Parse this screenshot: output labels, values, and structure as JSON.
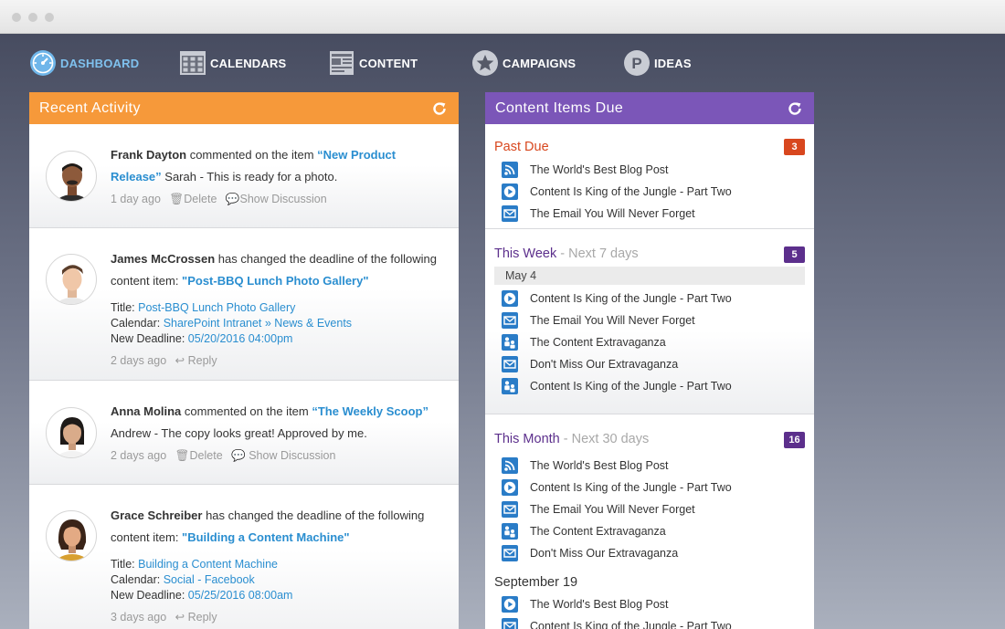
{
  "colors": {
    "accent_blue": "#2a8ed0",
    "orange": "#f6993a",
    "purple": "#7b56b8",
    "red": "#d8471e",
    "dark_purple": "#5c2f8c"
  },
  "nav": [
    {
      "label": "DASHBOARD",
      "icon": "dashboard-icon",
      "active": true
    },
    {
      "label": "CALENDARS",
      "icon": "calendar-icon"
    },
    {
      "label": "CONTENT",
      "icon": "content-icon"
    },
    {
      "label": "CAMPAIGNS",
      "icon": "star-icon"
    },
    {
      "label": "IDEAS",
      "icon": "ideas-icon"
    }
  ],
  "recent": {
    "title": "Recent Activity",
    "items": [
      {
        "name": "Frank Dayton",
        "action": " commented on the item ",
        "link": "“New Product Release”",
        "comment": " Sarah - This is ready for a photo.",
        "time": "1 day ago",
        "a1": "Delete",
        "a2": "Show Discussion"
      },
      {
        "name": "James McCrossen",
        "action": " has changed the deadline of the following content item: ",
        "link": "\"Post-BBQ Lunch Photo Gallery\"",
        "t_label": "Title: ",
        "t_val": "Post-BBQ Lunch Photo Gallery",
        "c_label": "Calendar: ",
        "c_val": "SharePoint Intranet » News & Events",
        "d_label": "New Deadline: ",
        "d_val": "05/20/2016 04:00pm",
        "time": "2 days ago",
        "a1": "Reply"
      },
      {
        "name": "Anna Molina",
        "action": " commented on the item ",
        "link": "“The Weekly Scoop”",
        "comment": "Andrew - The copy looks great! Approved by me.",
        "time": "2 days ago",
        "a1": "Delete",
        "a2": "Show Discussion"
      },
      {
        "name": "Grace Schreiber",
        "action": " has changed the deadline of the following content item: ",
        "link": "\"Building a Content Machine\"",
        "t_label": "Title: ",
        "t_val": "Building a Content Machine",
        "c_label": "Calendar: ",
        "c_val": "Social - Facebook",
        "d_label": "New Deadline: ",
        "d_val": "05/25/2016 08:00am",
        "time": "3 days ago",
        "a1": "Reply"
      }
    ]
  },
  "due": {
    "title": "Content Items Due",
    "past": {
      "title": "Past Due",
      "count": "3",
      "items": [
        {
          "icon": "rss-icon",
          "label": "The World's Best Blog Post"
        },
        {
          "icon": "video-icon",
          "label": "Content Is King of the Jungle - Part Two"
        },
        {
          "icon": "email-icon",
          "label": "The Email You Will Never Forget"
        }
      ]
    },
    "week": {
      "title": "This Week",
      "sub": " - Next 7 days",
      "count": "5",
      "day": "May 4",
      "items": [
        {
          "icon": "video-icon",
          "label": "Content Is King of the Jungle - Part Two"
        },
        {
          "icon": "email-icon",
          "label": "The Email You Will Never Forget"
        },
        {
          "icon": "people-icon",
          "label": "The Content Extravaganza"
        },
        {
          "icon": "email-icon",
          "label": "Don't Miss Our Extravaganza"
        },
        {
          "icon": "people-icon",
          "label": "Content Is King of the Jungle - Part Two"
        }
      ]
    },
    "month": {
      "title": "This Month",
      "sub": " - Next 30 days",
      "count": "16",
      "items": [
        {
          "icon": "rss-icon",
          "label": "The World's Best Blog Post"
        },
        {
          "icon": "video-icon",
          "label": "Content Is King of the Jungle - Part Two"
        },
        {
          "icon": "email-icon",
          "label": "The Email You Will Never Forget"
        },
        {
          "icon": "people-icon",
          "label": "The Content Extravaganza"
        },
        {
          "icon": "email-icon",
          "label": "Don't Miss Our Extravaganza"
        }
      ],
      "day": "September 19",
      "items2": [
        {
          "icon": "video-icon",
          "label": "The World's Best Blog Post"
        },
        {
          "icon": "email-icon",
          "label": "Content Is King of the Jungle - Part Two"
        }
      ]
    }
  }
}
